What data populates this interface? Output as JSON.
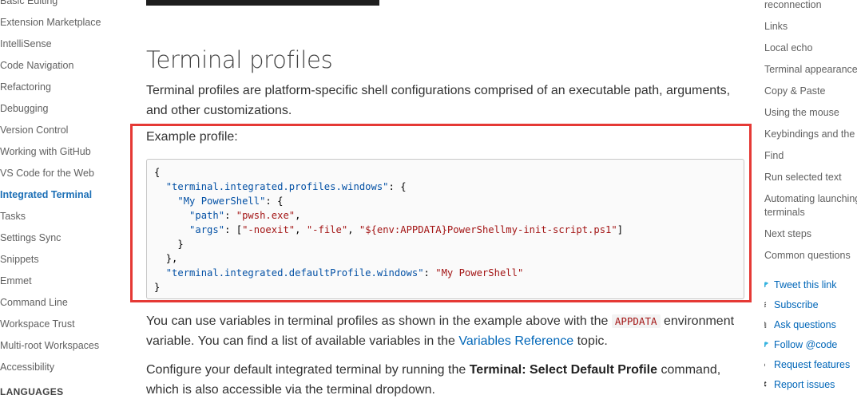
{
  "left_nav": {
    "items": [
      {
        "label": "Basic Editing",
        "active": false
      },
      {
        "label": "Extension Marketplace",
        "active": false
      },
      {
        "label": "IntelliSense",
        "active": false
      },
      {
        "label": "Code Navigation",
        "active": false
      },
      {
        "label": "Refactoring",
        "active": false
      },
      {
        "label": "Debugging",
        "active": false
      },
      {
        "label": "Version Control",
        "active": false
      },
      {
        "label": "Working with GitHub",
        "active": false
      },
      {
        "label": "VS Code for the Web",
        "active": false
      },
      {
        "label": "Integrated Terminal",
        "active": true
      },
      {
        "label": "Tasks",
        "active": false
      },
      {
        "label": "Settings Sync",
        "active": false
      },
      {
        "label": "Snippets",
        "active": false
      },
      {
        "label": "Emmet",
        "active": false
      },
      {
        "label": "Command Line",
        "active": false
      },
      {
        "label": "Workspace Trust",
        "active": false
      },
      {
        "label": "Multi-root Workspaces",
        "active": false
      },
      {
        "label": "Accessibility",
        "active": false
      }
    ],
    "section_heading": "LANGUAGES"
  },
  "main": {
    "heading": "Terminal profiles",
    "intro": "Terminal profiles are platform-specific shell configurations comprised of an executable path, arguments, and other customizations.",
    "example_label": "Example profile:",
    "code": {
      "l1": "{",
      "l2_key": "\"terminal.integrated.profiles.windows\"",
      "l2_rest": ": {",
      "l3_key": "\"My PowerShell\"",
      "l3_rest": ": {",
      "l4_key": "\"path\"",
      "l4_sep": ": ",
      "l4_val": "\"pwsh.exe\"",
      "l4_end": ",",
      "l5_key": "\"args\"",
      "l5_sep": ": [",
      "l5_a1": "\"-noexit\"",
      "l5_c1": ", ",
      "l5_a2": "\"-file\"",
      "l5_c2": ", ",
      "l5_a3": "\"${env:APPDATA}PowerShellmy-init-script.ps1\"",
      "l5_end": "]",
      "l6": "}",
      "l7": "},",
      "l8_key": "\"terminal.integrated.defaultProfile.windows\"",
      "l8_sep": ": ",
      "l8_val": "\"My PowerShell\"",
      "l9": "}"
    },
    "para2_a": "You can use variables in terminal profiles as shown in the example above with the",
    "para2_code": "APPDATA",
    "para2_b": "environment variable. You can find a list of available variables in the",
    "para2_link": "Variables Reference",
    "para2_c": "topic.",
    "para3_a": "Configure your default integrated terminal by running the",
    "para3_bold": "Terminal: Select Default Profile",
    "para3_b": "command, which is also accessible via the terminal dropdown."
  },
  "right_nav": {
    "toc": [
      "reconnection",
      "Links",
      "Local echo",
      "Terminal appearance",
      "Copy & Paste",
      "Using the mouse",
      "Keybindings and the s",
      "Find",
      "Run selected text",
      "Automating launching",
      "terminals",
      "Next steps",
      "Common questions"
    ],
    "social": [
      {
        "label": "Tweet this link",
        "icon": "twitter-icon"
      },
      {
        "label": "Subscribe",
        "icon": "rss-icon"
      },
      {
        "label": "Ask questions",
        "icon": "stackoverflow-icon"
      },
      {
        "label": "Follow @code",
        "icon": "twitter-icon"
      },
      {
        "label": "Request features",
        "icon": "github-icon"
      },
      {
        "label": "Report issues",
        "icon": "bug-icon"
      }
    ]
  },
  "colors": {
    "accent_link": "#0066b8",
    "active_nav": "#1c6fb6",
    "highlight_border": "#e53935"
  }
}
